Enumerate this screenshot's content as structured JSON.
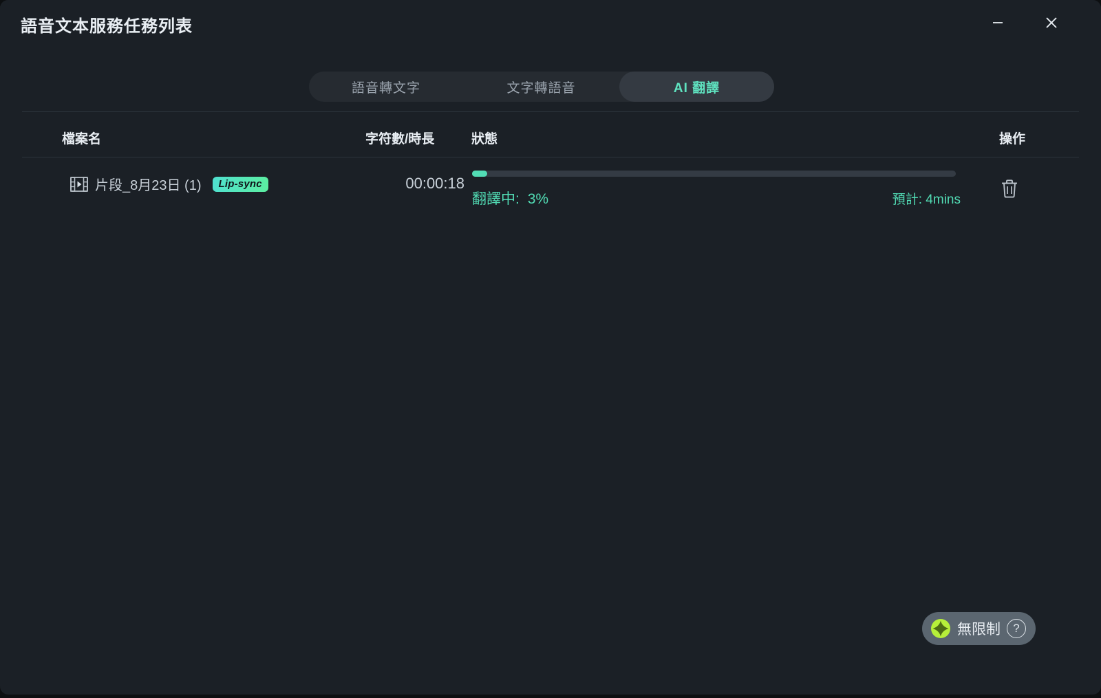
{
  "window": {
    "title": "語音文本服務任務列表",
    "minimize_label": "minimize",
    "close_label": "close"
  },
  "tabs": [
    {
      "label": "語音轉文字",
      "active": false
    },
    {
      "label": "文字轉語音",
      "active": false
    },
    {
      "label": "AI 翻譯",
      "active": true
    }
  ],
  "table": {
    "columns": [
      {
        "key": "file",
        "label": "檔案名"
      },
      {
        "key": "duration",
        "label": "字符數/時長"
      },
      {
        "key": "status",
        "label": "狀態"
      },
      {
        "key": "action",
        "label": "操作"
      }
    ],
    "rows": [
      {
        "file_icon": "film-strip-icon",
        "file_name": "片段_8月23日 (1)",
        "badge": "Lip-sync",
        "duration": "00:00:18",
        "status_label": "翻譯中:",
        "status_percent": "3%",
        "progress_value": 3,
        "eta": "預計: 4mins",
        "action_icon": "trash-icon"
      }
    ]
  },
  "footer": {
    "credits_icon": "sparkle-icon",
    "credits_label": "無限制",
    "help_icon": "question-mark-icon",
    "help_label": "?"
  },
  "colors": {
    "window_bg": "#1b2026",
    "accent_teal": "#52ddb5",
    "tab_track": "#262b31",
    "tab_active_bg": "#343a42",
    "text_primary": "#e9eef3",
    "text_secondary": "#c8d0d8",
    "text_muted": "#9aa3ad",
    "divider": "#2d343c",
    "badge_grad_from": "#4fe0d0",
    "badge_grad_to": "#5ceea0",
    "credits_bg": "#5b6670",
    "sparkle_green": "#b6ef3a"
  }
}
